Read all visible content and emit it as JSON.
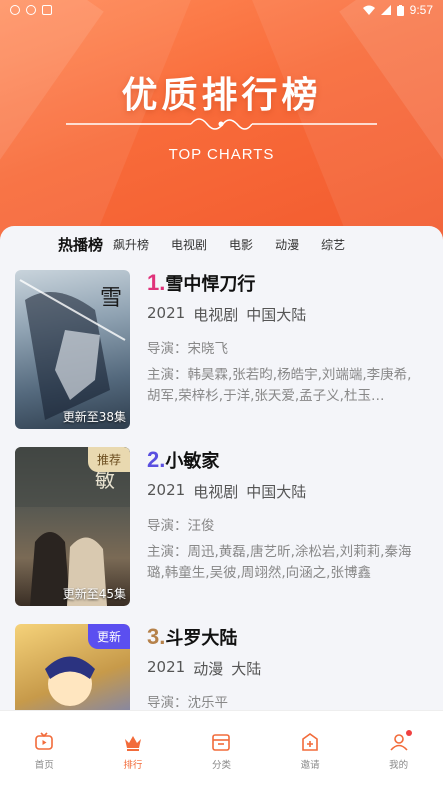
{
  "status_bar": {
    "time": "9:57"
  },
  "hero": {
    "title": "优质排行榜",
    "subtitle": "TOP CHARTS"
  },
  "tabs": [
    "热播榜",
    "飙升榜",
    "电视剧",
    "电影",
    "动漫",
    "综艺"
  ],
  "items": [
    {
      "rank": "1.",
      "rank_color": "#e0327a",
      "title": "雪中悍刀行",
      "year": "2021",
      "type": "电视剧",
      "region": "中国大陆",
      "director": "导演：宋晓飞",
      "cast": "主演：韩昊霖,张若昀,杨皓宇,刘端端,李庚希,胡军,荣梓杉,于洋,张天爱,孟子义,杜玉…",
      "update": "更新至38集",
      "badge": ""
    },
    {
      "rank": "2.",
      "rank_color": "#5a4fe0",
      "title": "小敏家",
      "year": "2021",
      "type": "电视剧",
      "region": "中国大陆",
      "director": "导演：汪俊",
      "cast": "主演：周迅,黄磊,唐艺昕,涂松岩,刘莉莉,秦海璐,韩童生,吴彼,周翊然,向涵之,张博鑫",
      "update": "更新至45集",
      "badge": "推荐"
    },
    {
      "rank": "3.",
      "rank_color": "#b5814a",
      "title": "斗罗大陆",
      "year": "2021",
      "type": "动漫",
      "region": "大陆",
      "director": "导演：沈乐平",
      "cast": "",
      "update": "",
      "badge": "更新"
    }
  ],
  "bottom_nav": [
    {
      "label": "首页",
      "icon": "tv-icon"
    },
    {
      "label": "排行",
      "icon": "crown-icon",
      "active": true
    },
    {
      "label": "分类",
      "icon": "category-box-icon"
    },
    {
      "label": "邀请",
      "icon": "invite-icon"
    },
    {
      "label": "我的",
      "icon": "user-icon",
      "has_dot": true
    }
  ],
  "colors": {
    "accent": "#f26b3a",
    "hero_start": "#ff8a57",
    "hero_end": "#f25a2e"
  }
}
